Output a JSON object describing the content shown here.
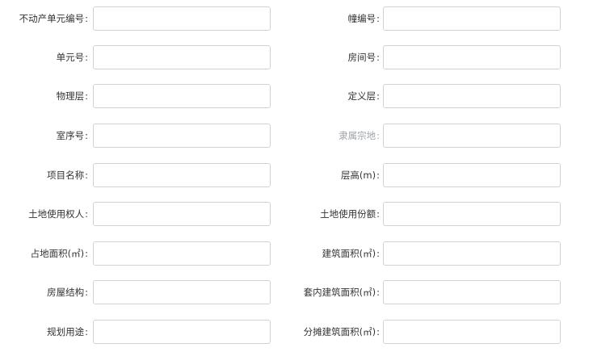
{
  "form": {
    "rows": [
      {
        "left": {
          "label": "不动产单元编号",
          "value": "",
          "placeholder": ""
        },
        "right": {
          "label": "幢编号",
          "value": "",
          "placeholder": ""
        }
      },
      {
        "left": {
          "label": "单元号",
          "value": "",
          "placeholder": ""
        },
        "right": {
          "label": "房间号",
          "value": "",
          "placeholder": ""
        }
      },
      {
        "left": {
          "label": "物理层",
          "value": "",
          "placeholder": ""
        },
        "right": {
          "label": "定义层",
          "value": "",
          "placeholder": ""
        }
      },
      {
        "left": {
          "label": "室序号",
          "value": "",
          "placeholder": ""
        },
        "right": {
          "label": "隶属宗地",
          "value": "",
          "placeholder": "",
          "disabled": true
        }
      },
      {
        "left": {
          "label": "项目名称",
          "value": "",
          "placeholder": ""
        },
        "right": {
          "label": "层高(m)",
          "value": "",
          "placeholder": ""
        }
      },
      {
        "left": {
          "label": "土地使用权人",
          "value": "",
          "placeholder": ""
        },
        "right": {
          "label": "土地使用份额",
          "value": "",
          "placeholder": ""
        }
      },
      {
        "left": {
          "label": "占地面积(㎡)",
          "value": "",
          "placeholder": ""
        },
        "right": {
          "label": "建筑面积(㎡)",
          "value": "",
          "placeholder": ""
        }
      },
      {
        "left": {
          "label": "房屋结构",
          "value": "",
          "placeholder": ""
        },
        "right": {
          "label": "套内建筑面积(㎡)",
          "value": "",
          "placeholder": ""
        }
      },
      {
        "left": {
          "label": "规划用途",
          "value": "",
          "placeholder": ""
        },
        "right": {
          "label": "分摊建筑面积(㎡)",
          "value": "",
          "placeholder": ""
        }
      }
    ],
    "colon": ":",
    "colors": {
      "label": "#333333",
      "label_muted": "#a0a4aa",
      "input_border": "#cfd3d8"
    }
  }
}
